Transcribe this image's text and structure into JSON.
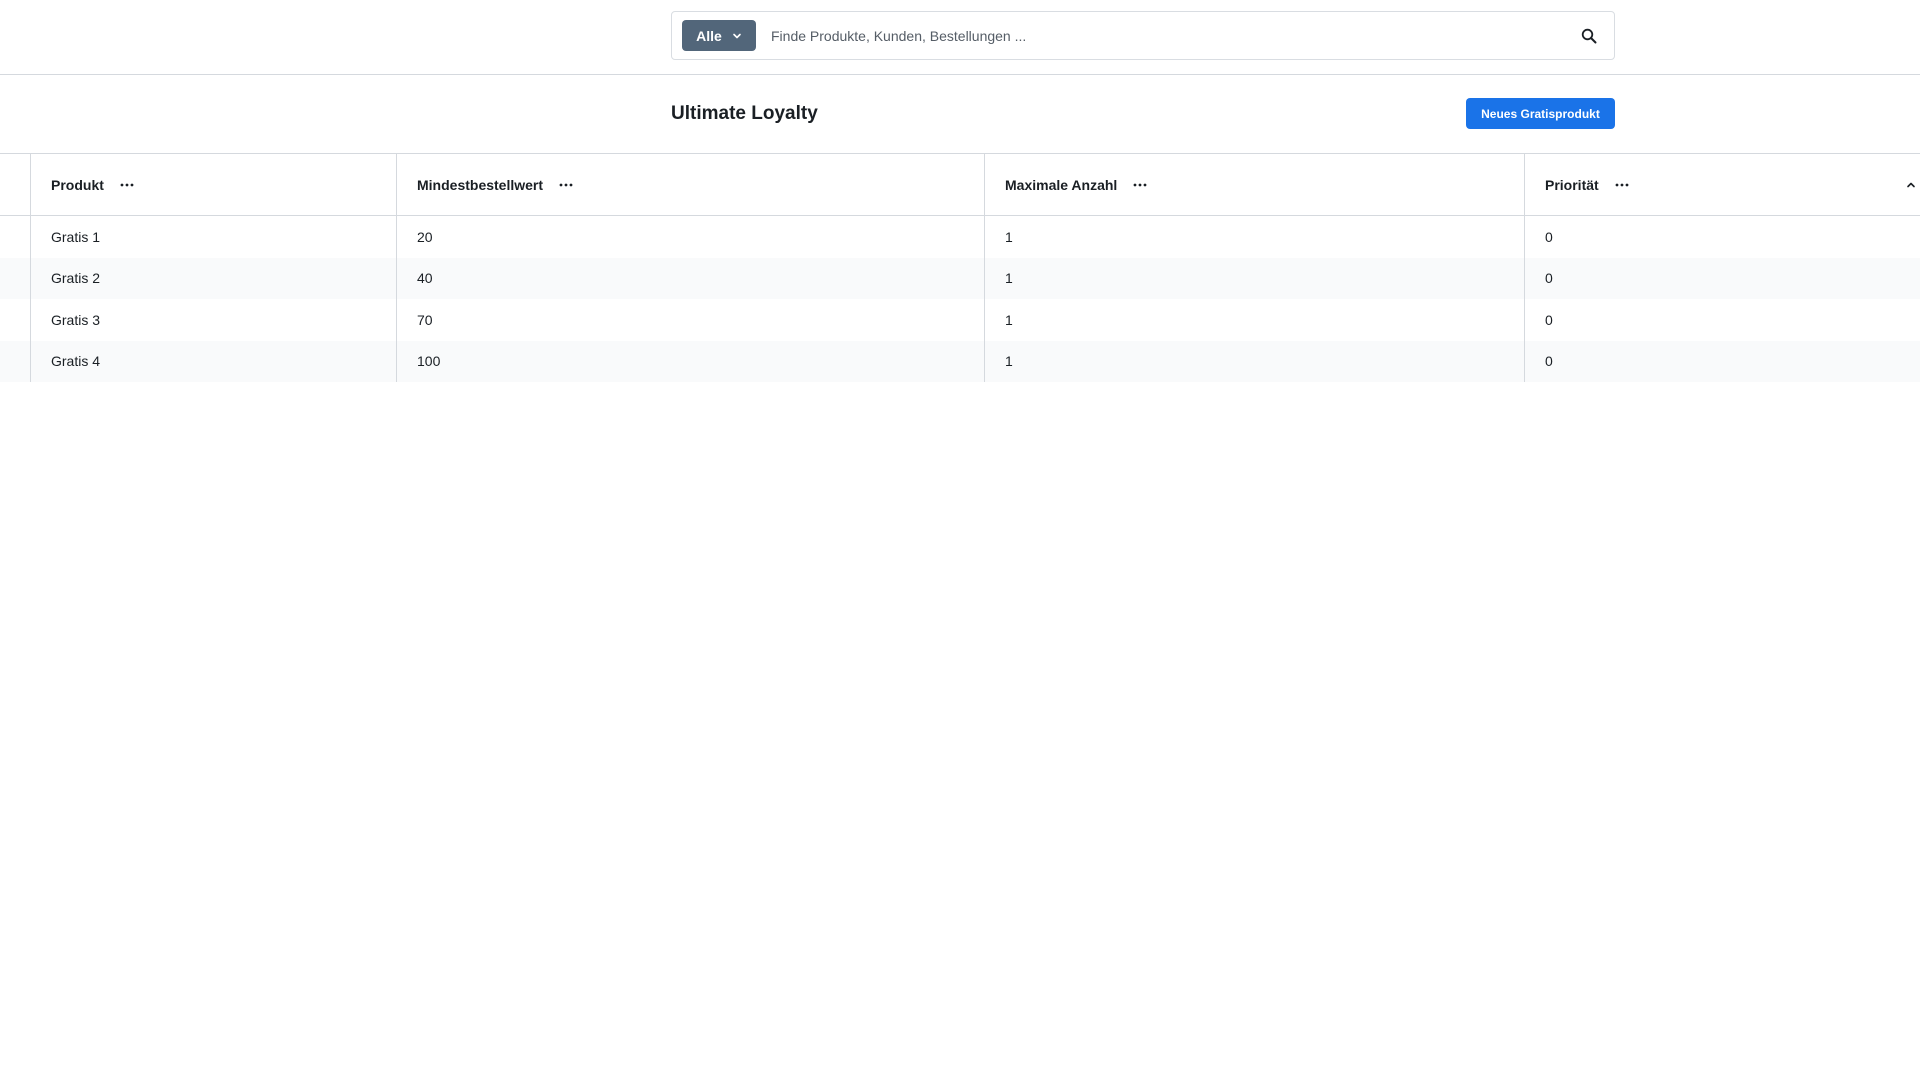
{
  "search": {
    "scope_label": "Alle",
    "placeholder": "Finde Produkte, Kunden, Bestellungen ...",
    "value": ""
  },
  "header": {
    "title": "Ultimate Loyalty",
    "new_button_label": "Neues Gratisprodukt"
  },
  "table": {
    "columns": [
      {
        "label": "Produkt"
      },
      {
        "label": "Mindestbestellwert"
      },
      {
        "label": "Maximale Anzahl"
      },
      {
        "label": "Priorität"
      }
    ],
    "rows": [
      [
        "Gratis 1",
        "20",
        "1",
        "0"
      ],
      [
        "Gratis 2",
        "40",
        "1",
        "0"
      ],
      [
        "Gratis 3",
        "70",
        "1",
        "0"
      ],
      [
        "Gratis 4",
        "100",
        "1",
        "0"
      ]
    ]
  },
  "colors": {
    "primary": "#1a73e8",
    "scope_bg": "#52667a",
    "border": "#d5d9de",
    "row_alt": "#f9fafb"
  }
}
